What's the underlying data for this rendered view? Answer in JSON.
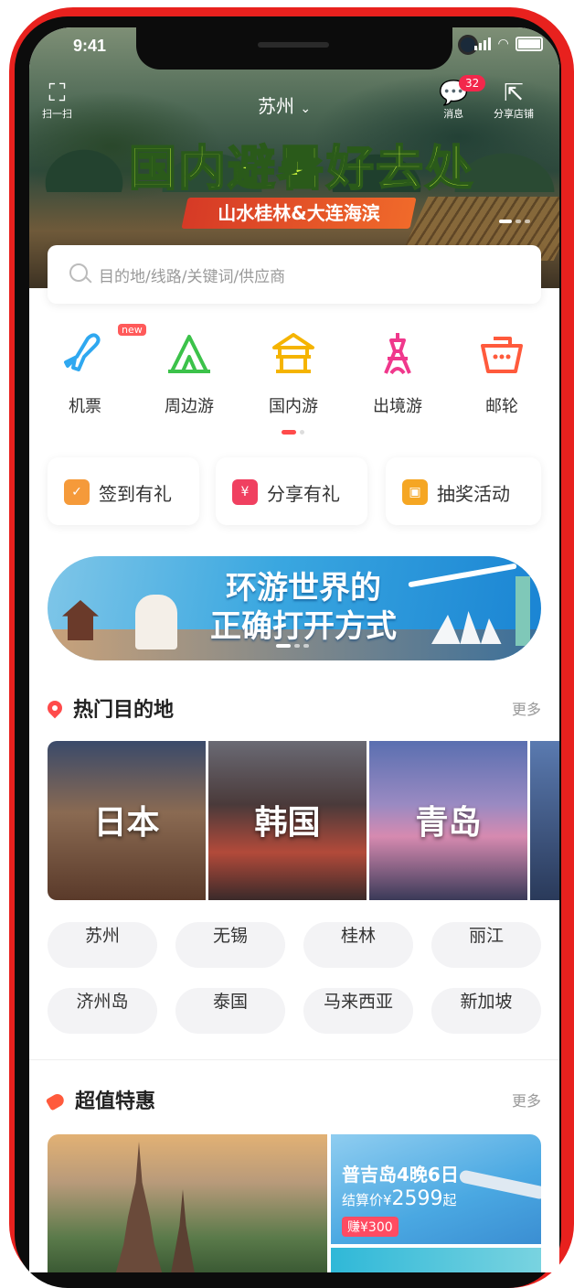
{
  "status": {
    "time": "9:41"
  },
  "header": {
    "scan_label": "扫一扫",
    "city": "苏州",
    "messages_label": "消息",
    "messages_badge": "32",
    "share_label": "分享店铺"
  },
  "hero": {
    "title": "国内避暑好去处",
    "subtitle": "山水桂林&大连海滨"
  },
  "search": {
    "placeholder": "目的地/线路/关键词/供应商"
  },
  "categories": [
    {
      "label": "机票",
      "icon": "plane-icon",
      "badge": "new",
      "color": "#2fa8f0"
    },
    {
      "label": "周边游",
      "icon": "tent-icon",
      "color": "#3cc24a"
    },
    {
      "label": "国内游",
      "icon": "pavilion-icon",
      "color": "#f5b400"
    },
    {
      "label": "出境游",
      "icon": "tower-icon",
      "color": "#f0388c"
    },
    {
      "label": "邮轮",
      "icon": "cruise-icon",
      "color": "#ff5a3c"
    }
  ],
  "promos": [
    {
      "label": "签到有礼",
      "icon": "calendar-check-icon",
      "color": "#f59a3a"
    },
    {
      "label": "分享有礼",
      "icon": "red-packet-icon",
      "color": "#f04060"
    },
    {
      "label": "抽奖活动",
      "icon": "gift-icon",
      "color": "#f5a623"
    }
  ],
  "banner": {
    "line1": "环游世界的",
    "line2": "正确打开方式"
  },
  "hot_destinations": {
    "title": "热门目的地",
    "more": "更多",
    "cards": [
      "日本",
      "韩国",
      "青岛"
    ],
    "chips": [
      "苏州",
      "无锡",
      "桂林",
      "丽江",
      "济州岛",
      "泰国",
      "马来西亚",
      "新加坡"
    ]
  },
  "deals": {
    "title": "超值特惠",
    "more": "更多",
    "item": {
      "name": "普吉岛4晚6日",
      "price_prefix": "结算价¥",
      "price": "2599",
      "price_suffix": "起",
      "earn": "赚¥300"
    }
  },
  "accent_color": "#ff4b4b"
}
